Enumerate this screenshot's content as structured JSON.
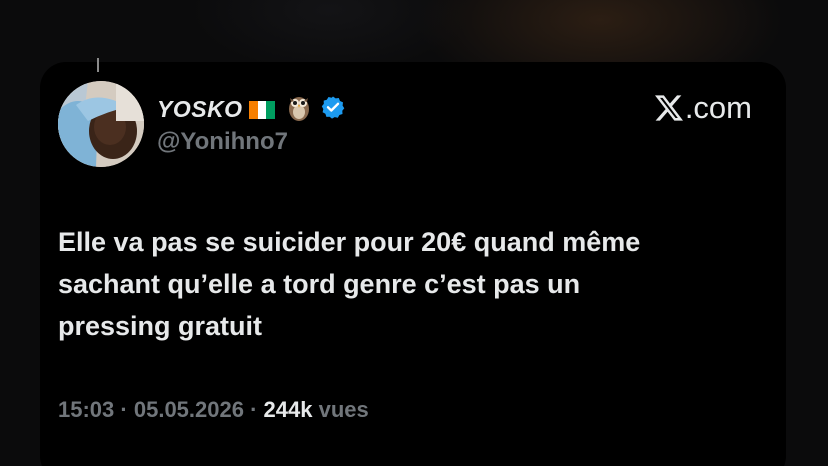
{
  "tweet": {
    "display_name": "YOSKO",
    "handle": "@Yonihno7",
    "brand": ".com",
    "text_lines": [
      "Elle va pas se suicider pour 20€ quand même",
      "sachant qu’elle a tord genre c’est pas un",
      "pressing gratuit"
    ],
    "time": "15:03",
    "separator": "·",
    "date": "05.05.2026",
    "views_count": "244k",
    "views_label": "vues"
  },
  "icons": {
    "flag": "ivory-coast-flag-icon",
    "owl": "owl-emoji-icon",
    "verified": "verified-badge-icon",
    "logo": "x-logo-icon"
  },
  "colors": {
    "background": "#000000",
    "text_primary": "#e7e9ea",
    "text_secondary": "#71767b",
    "verified": "#1d9bf0"
  }
}
